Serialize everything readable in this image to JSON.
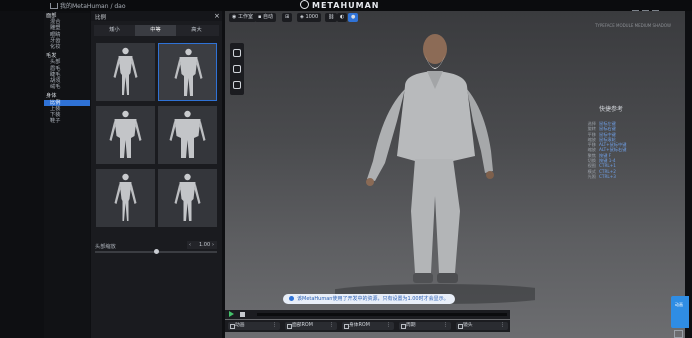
{
  "topbar": {
    "breadcrumb": "我的MetaHuman / dao",
    "logo": "METAHUMAN"
  },
  "leftnav": {
    "groups": [
      {
        "title": "面部",
        "items": [
          "混合",
          "雕塑",
          "眼睛",
          "牙齿",
          "化妆"
        ]
      },
      {
        "title": "毛发",
        "items": [
          "头部",
          "眉毛",
          "睫毛",
          "胡须",
          "绒毛"
        ]
      },
      {
        "title": "身体",
        "items": [
          "比例",
          "上装",
          "下装",
          "鞋子"
        ]
      }
    ],
    "selected": "比例"
  },
  "panel": {
    "title": "比例",
    "close_icon": "close-icon",
    "tabs": [
      "矮小",
      "中等",
      "高大"
    ],
    "selected_tab": "中等",
    "selected_card": 1,
    "slider_label": "头部缩放",
    "slider_value": "1.00",
    "slider_level": 0.5
  },
  "viewport": {
    "tools": {
      "environment": "工作室",
      "camera": "自动",
      "lod": "1000"
    },
    "faint_top_right": "TYPEFACE MODULE MEDIUM SHADOW",
    "ref_title": "快捷参考",
    "ref_rows": [
      [
        "选择",
        "鼠标左键"
      ],
      [
        "旋转",
        "鼠标右键"
      ],
      [
        "平移",
        "鼠标中键"
      ],
      [
        "缩放",
        "鼠标滚轮"
      ],
      [
        "平移",
        "ALT+鼠标中键"
      ],
      [
        "缩放",
        "ALT+鼠标右键"
      ],
      [
        "聚焦",
        "按键 F"
      ],
      [
        "切换",
        "按键 1-4"
      ],
      [
        "视图",
        "CTRL+1"
      ],
      [
        "模式",
        "CTRL+2"
      ],
      [
        "光照",
        "CTRL+3"
      ]
    ],
    "notice": "该MetaHuman使用了开发中的资源，只有设置为1.00时才会显示。"
  },
  "playback": {
    "chips": [
      "动画",
      "面部ROM",
      "身体ROM",
      "周期",
      "镜头"
    ]
  },
  "right_tab": {
    "label": "动画"
  },
  "colors": {
    "accent": "#2f72d6",
    "play_green": "#44c26a",
    "background": "#0e0f12"
  }
}
